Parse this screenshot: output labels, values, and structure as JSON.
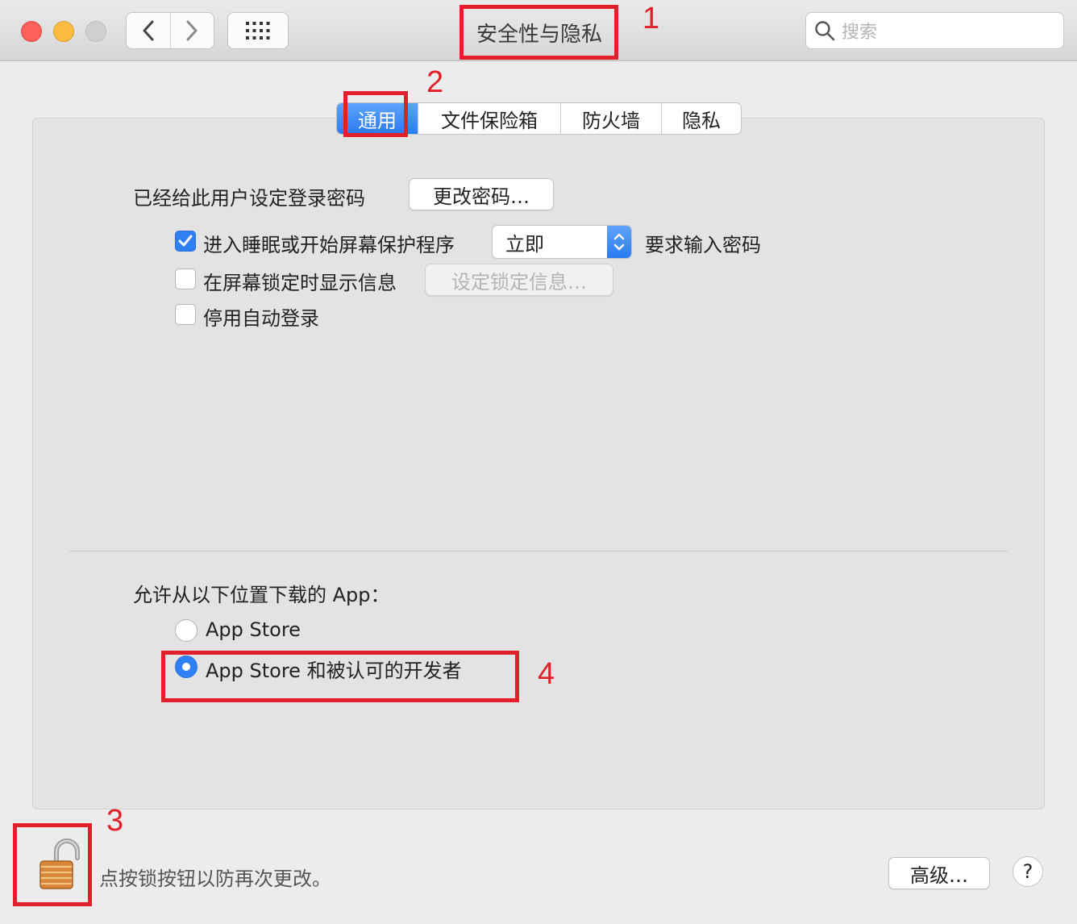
{
  "window": {
    "title": "安全性与隐私",
    "search_placeholder": "搜索"
  },
  "tabs": [
    {
      "label": "通用",
      "active": true
    },
    {
      "label": "文件保险箱",
      "active": false
    },
    {
      "label": "防火墙",
      "active": false
    },
    {
      "label": "隐私",
      "active": false
    }
  ],
  "general": {
    "password_label": "已经给此用户设定登录密码",
    "change_password_button": "更改密码…",
    "require_password": {
      "checked": true,
      "prefix": "进入睡眠或开始屏幕保护程序",
      "select_value": "立即",
      "suffix": "要求输入密码"
    },
    "show_message": {
      "checked": false,
      "label": "在屏幕锁定时显示信息",
      "button": "设定锁定信息…"
    },
    "disable_autologin": {
      "checked": false,
      "label": "停用自动登录"
    }
  },
  "downloads": {
    "heading": "允许从以下位置下载的 App：",
    "options": [
      {
        "label": "App Store",
        "selected": false
      },
      {
        "label": "App Store 和被认可的开发者",
        "selected": true
      }
    ]
  },
  "footer": {
    "lock_text": "点按锁按钮以防再次更改。",
    "advanced_button": "高级…",
    "help_label": "?"
  },
  "annotations": [
    "1",
    "2",
    "3",
    "4"
  ],
  "colors": {
    "accent": "#2f7ff5",
    "annotation": "#e0202a"
  }
}
